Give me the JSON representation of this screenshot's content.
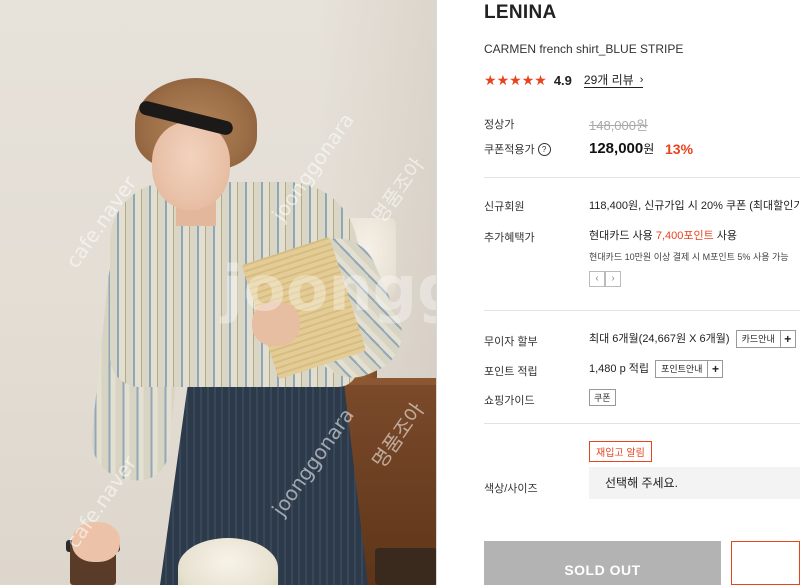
{
  "product": {
    "brand": "LENINA",
    "name": "CARMEN french shirt_BLUE STRIPE",
    "rating": "4.9",
    "stars": 5,
    "review_link": "29개 리뷰",
    "watermarks": [
      "cafe.naver",
      "명품조아",
      "joonggonara",
      "joonggo"
    ]
  },
  "price": {
    "list_label": "정상가",
    "list_price": "148,000원",
    "coupon_label": "쿠폰적용가",
    "help_icon": "question-circle-icon",
    "coupon_price": "128,000",
    "coupon_unit": "원",
    "discount": "13%"
  },
  "benefits": {
    "new_member_label": "신규회원",
    "new_member_text": "118,400원, 신규가입 시 20% 쿠폰 (최대할인가)",
    "extra_label": "추가혜택가",
    "extra_prefix": "현대카드 사용 ",
    "extra_points": "7,400포인트",
    "extra_suffix": " 사용",
    "extra_note": "현대카드 10만원 이상 결제 시 M포인트 5% 사용 가능",
    "prev_icon": "chevron-left-icon",
    "next_icon": "chevron-right-icon"
  },
  "installment": {
    "label": "무이자 할부",
    "text": "최대 6개월(24,667원 X 6개월)",
    "card_button": "카드안내"
  },
  "points": {
    "label": "포인트 적립",
    "text": "1,480 p 적립",
    "info_button": "포인트안내"
  },
  "shopping": {
    "label": "쇼핑가이드",
    "coupon_tag": "쿠폰"
  },
  "restock": {
    "button": "재입고 알림"
  },
  "option": {
    "label": "색상/사이즈",
    "placeholder": "선택해 주세요."
  },
  "actions": {
    "soldout": "SOLD OUT"
  },
  "colors": {
    "accent": "#e8431d",
    "soldout_bg": "#b3b3b3"
  }
}
